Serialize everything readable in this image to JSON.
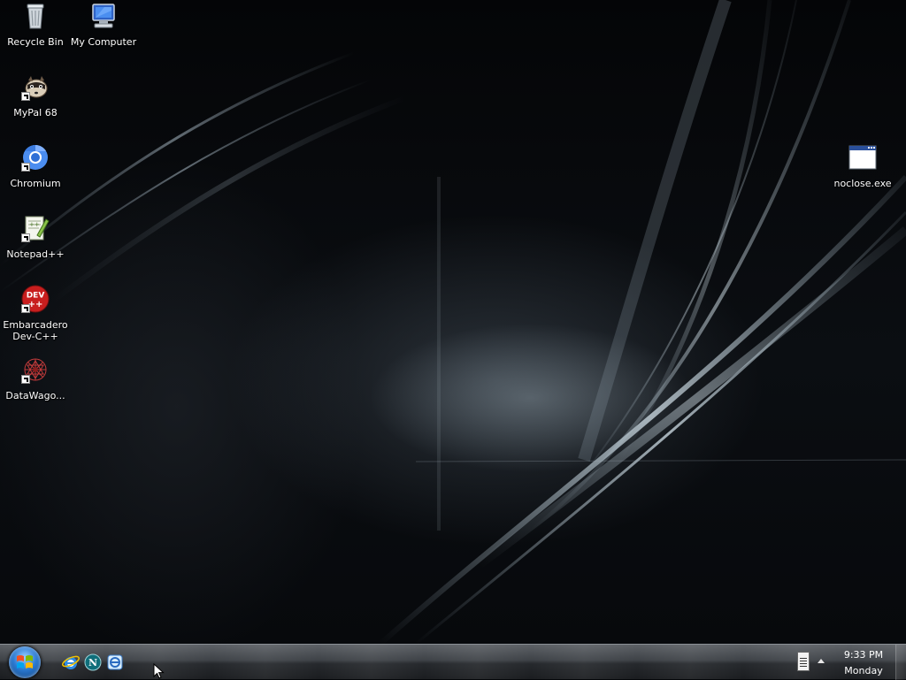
{
  "desktop": {
    "icons": [
      {
        "id": "recycle-bin",
        "label": "Recycle Bin",
        "icon": "recycle-bin-icon"
      },
      {
        "id": "my-computer",
        "label": "My Computer",
        "icon": "computer-icon"
      },
      {
        "id": "mypal",
        "label": "MyPal 68",
        "icon": "mypal-raccoon-icon",
        "shortcut": true
      },
      {
        "id": "chromium",
        "label": "Chromium",
        "icon": "chromium-icon",
        "shortcut": true
      },
      {
        "id": "notepadpp",
        "label": "Notepad++",
        "icon": "notepadpp-icon",
        "shortcut": true
      },
      {
        "id": "devcpp",
        "label_line1": "Embarcadero",
        "label_line2": "Dev-C++",
        "icon_text": "DEV\n++",
        "icon": "devcpp-icon",
        "shortcut": true
      },
      {
        "id": "datawagon",
        "label": "DataWago...",
        "icon": "datawagon-icon",
        "shortcut": true
      },
      {
        "id": "noclose",
        "label": "noclose.exe",
        "icon": "window-app-icon"
      }
    ]
  },
  "taskbar": {
    "start_icon": "windows-logo-icon",
    "quick_launch": [
      {
        "name": "internet-explorer",
        "icon": "ie-icon"
      },
      {
        "name": "netscape",
        "icon": "netscape-icon"
      },
      {
        "name": "third-browser",
        "icon": "browser-e-icon"
      }
    ],
    "tray": {
      "keyboard_icon": "keyboard-icon",
      "expand_icon": "show-hidden-icons-icon",
      "time": "9:33 PM",
      "day": "Monday"
    }
  },
  "colors": {
    "label_text": "#ffffff",
    "taskbar_top": "#5d6166",
    "taskbar_bottom": "#1b1d20"
  }
}
